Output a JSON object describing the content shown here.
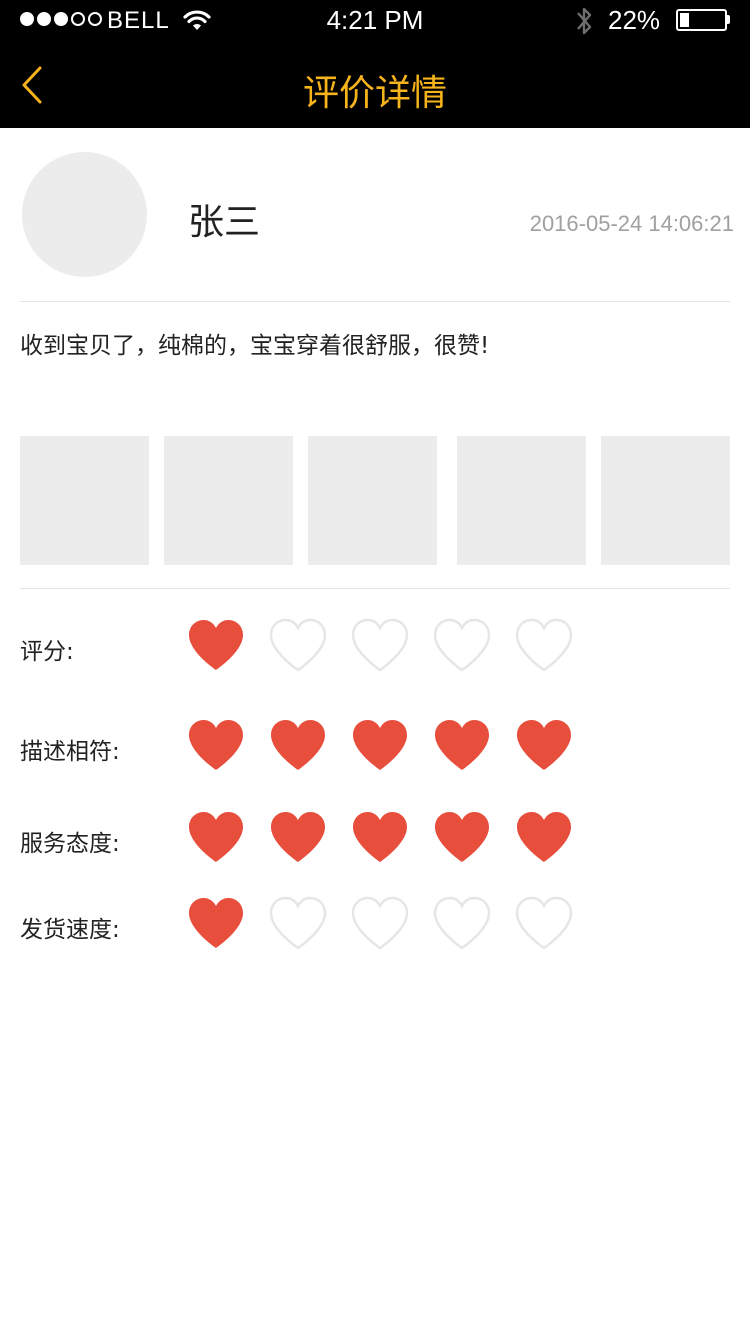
{
  "status_bar": {
    "signal_dots": [
      true,
      true,
      true,
      false,
      false
    ],
    "carrier": "BELL",
    "time": "4:21 PM",
    "battery": "22%",
    "battery_level": 0.22
  },
  "nav": {
    "title": "评价详情",
    "back_icon": "chevron-left-icon"
  },
  "review": {
    "user_name": "张三",
    "timestamp": "2016-05-24 14:06:21",
    "text": "收到宝贝了，纯棉的，宝宝穿着很舒服，很赞!",
    "photo_count": 5
  },
  "ratings": [
    {
      "label": "评分:",
      "value": 1,
      "max": 5
    },
    {
      "label": "描述相符:",
      "value": 5,
      "max": 5
    },
    {
      "label": "服务态度:",
      "value": 5,
      "max": 5
    },
    {
      "label": "发货速度:",
      "value": 1,
      "max": 5
    }
  ],
  "colors": {
    "header_bg": "#000000",
    "accent": "#f6b31c",
    "heart_filled": "#e84e3c",
    "heart_empty_stroke": "#e6e6e6",
    "placeholder": "#ececec"
  }
}
